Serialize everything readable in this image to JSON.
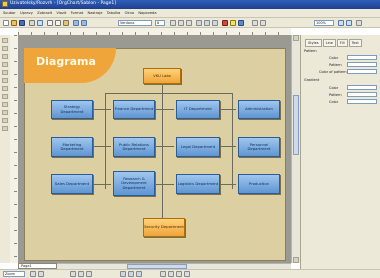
{
  "window": {
    "title": "Uzivatelsky/Rozvrh - [OrgChart/Sablon - Page1]"
  },
  "menu": {
    "items": [
      "Soubor",
      "Upravy",
      "Zobrazit",
      "Vlozit",
      "Format",
      "Nastroje",
      "Tabulka",
      "Okno",
      "Napoveda"
    ]
  },
  "toolbar": {
    "font_name": "Verdana",
    "font_size": "8",
    "zoom": "100%"
  },
  "diagram": {
    "title": "Diagrama",
    "nodes": {
      "vp_labs": "VKU Labs",
      "strategy": "Strategy Department",
      "finance": "Finance Department",
      "it": "IT Department",
      "administration": "Administration",
      "marketing": "Marketing Department",
      "public_relations": "Public Relations Department",
      "legal": "Legal Department",
      "personnel": "Personnel Department",
      "sales": "Sales Department",
      "research": "Research & Development Department",
      "logistics": "Logistics Department",
      "production": "Production",
      "security": "Security Department"
    }
  },
  "status": {
    "page_tab": "Page1",
    "zoom_box": "Zoom"
  },
  "right_panel": {
    "tabs": [
      "Styles",
      "Line",
      "Fill",
      "Text"
    ],
    "section1": "Pattern",
    "section2": "Gradient",
    "labels": [
      "Color",
      "Pattern",
      "Color of pattern",
      "Color",
      "Pattern",
      "Color"
    ]
  }
}
